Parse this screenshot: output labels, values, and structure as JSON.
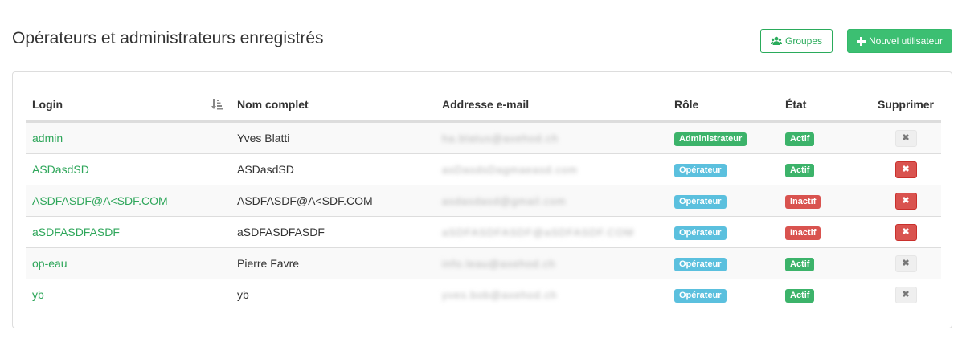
{
  "page": {
    "title": "Opérateurs et administrateurs enregistrés"
  },
  "toolbar": {
    "groups_label": "Groupes",
    "groups_icon": "users-icon",
    "new_user_label": "Nouvel utilisateur",
    "new_user_icon": "plus-icon"
  },
  "colors": {
    "accent_green": "#3cbf72",
    "info_blue": "#5bc0de",
    "danger_red": "#d9534f"
  },
  "table": {
    "columns": {
      "login": "Login",
      "nom": "Nom complet",
      "email": "Addresse e-mail",
      "role": "Rôle",
      "etat": "État",
      "supprimer": "Supprimer"
    },
    "sort_icon": "sort-amount-icon",
    "rows": [
      {
        "login": "admin",
        "nom": "Yves Blatti",
        "email": "ha.blatus@axehod.ch",
        "role": "Administrateur",
        "role_type": "admin",
        "etat": "Actif",
        "etat_type": "actif",
        "delete": "✖",
        "delete_enabled": false
      },
      {
        "login": "ASDasdSD",
        "nom": "ASDasdSD",
        "email": "asDasdsDagmaeasd.com",
        "role": "Opérateur",
        "role_type": "op",
        "etat": "Actif",
        "etat_type": "actif",
        "delete": "✖",
        "delete_enabled": true
      },
      {
        "login": "ASDFASDF@A<SDF.COM",
        "nom": "ASDFASDF@A<SDF.COM",
        "email": "asdasdasd@gmail.com",
        "role": "Opérateur",
        "role_type": "op",
        "etat": "Inactif",
        "etat_type": "inactif",
        "delete": "✖",
        "delete_enabled": true
      },
      {
        "login": "aSDFASDFASDF",
        "nom": "aSDFASDFASDF",
        "email": "aSDFASDFASDF@aSDFASDF.COM",
        "role": "Opérateur",
        "role_type": "op",
        "etat": "Inactif",
        "etat_type": "inactif",
        "delete": "✖",
        "delete_enabled": true
      },
      {
        "login": "op-eau",
        "nom": "Pierre Favre",
        "email": "info.leau@axehod.ch",
        "role": "Opérateur",
        "role_type": "op",
        "etat": "Actif",
        "etat_type": "actif",
        "delete": "✖",
        "delete_enabled": false
      },
      {
        "login": "yb",
        "nom": "yb",
        "email": "yves.bob@axehod.ch",
        "role": "Opérateur",
        "role_type": "op",
        "etat": "Actif",
        "etat_type": "actif",
        "delete": "✖",
        "delete_enabled": false
      }
    ]
  }
}
